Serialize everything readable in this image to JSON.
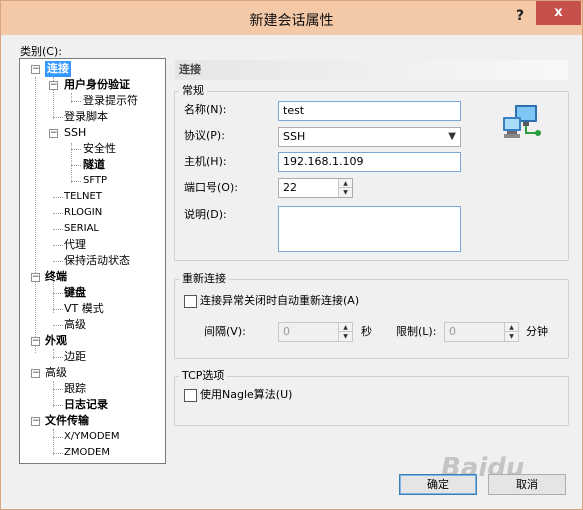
{
  "window": {
    "title": "新建会话属性",
    "help": "?",
    "close": "x"
  },
  "category_label": "类别(C):",
  "tree": [
    {
      "label": "连接",
      "bold": true,
      "selected": true
    },
    {
      "label": "用户身份验证",
      "bold": true
    },
    {
      "label": "登录提示符",
      "bold": false
    },
    {
      "label": "登录脚本",
      "bold": false
    },
    {
      "label": "SSH",
      "bold": false
    },
    {
      "label": "安全性",
      "bold": false
    },
    {
      "label": "隧道",
      "bold": true
    },
    {
      "label": "SFTP",
      "bold": false
    },
    {
      "label": "TELNET",
      "bold": false
    },
    {
      "label": "RLOGIN",
      "bold": false
    },
    {
      "label": "SERIAL",
      "bold": false
    },
    {
      "label": "代理",
      "bold": false
    },
    {
      "label": "保持活动状态",
      "bold": false
    },
    {
      "label": "终端",
      "bold": true
    },
    {
      "label": "键盘",
      "bold": true
    },
    {
      "label": "VT 模式",
      "bold": false
    },
    {
      "label": "高级",
      "bold": false
    },
    {
      "label": "外观",
      "bold": true
    },
    {
      "label": "边距",
      "bold": false
    },
    {
      "label": "高级",
      "bold": false
    },
    {
      "label": "跟踪",
      "bold": false
    },
    {
      "label": "日志记录",
      "bold": true
    },
    {
      "label": "文件传输",
      "bold": true
    },
    {
      "label": "X/YMODEM",
      "bold": false
    },
    {
      "label": "ZMODEM",
      "bold": false
    }
  ],
  "section_title": "连接",
  "general": {
    "title": "常规",
    "name_label": "名称(N):",
    "name_value": "test",
    "protocol_label": "协议(P):",
    "protocol_value": "SSH",
    "host_label": "主机(H):",
    "host_value": "192.168.1.109",
    "port_label": "端口号(O):",
    "port_value": "22",
    "desc_label": "说明(D):",
    "desc_value": ""
  },
  "reconnect": {
    "title": "重新连接",
    "checkbox_label": "连接异常关闭时自动重新连接(A)",
    "interval_label": "间隔(V):",
    "interval_value": "0",
    "interval_unit": "秒",
    "limit_label": "限制(L):",
    "limit_value": "0",
    "limit_unit": "分钟"
  },
  "tcp": {
    "title": "TCP选项",
    "checkbox_label": "使用Nagle算法(U)"
  },
  "buttons": {
    "ok": "确定",
    "cancel": "取消"
  },
  "watermark": "Baidu"
}
